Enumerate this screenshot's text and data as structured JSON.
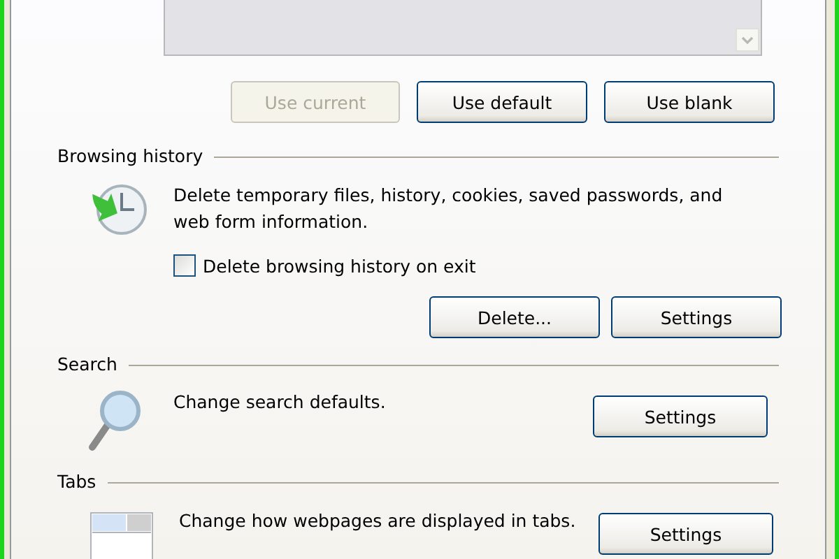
{
  "home_page": {
    "address_box": {
      "disabled": true
    },
    "buttons": [
      {
        "label": "Use current",
        "disabled": true
      },
      {
        "label": "Use default",
        "disabled": false
      },
      {
        "label": "Use blank",
        "disabled": false
      }
    ]
  },
  "sections": [
    {
      "title": "Browsing history",
      "kind": "history",
      "description": "Delete temporary files, history, cookies, saved passwords, and web form information.",
      "checkbox": {
        "label": "Delete browsing history on exit",
        "checked": false
      },
      "buttons": [
        {
          "label": "Delete...",
          "disabled": false
        },
        {
          "label": "Settings",
          "disabled": false
        }
      ]
    },
    {
      "title": "Search",
      "kind": "search",
      "description": "Change search defaults.",
      "buttons": [
        {
          "label": "Settings",
          "disabled": false
        }
      ]
    },
    {
      "title": "Tabs",
      "kind": "tabs",
      "description": "Change how webpages are displayed in tabs.",
      "buttons": [
        {
          "label": "Settings",
          "disabled": false
        }
      ]
    }
  ]
}
